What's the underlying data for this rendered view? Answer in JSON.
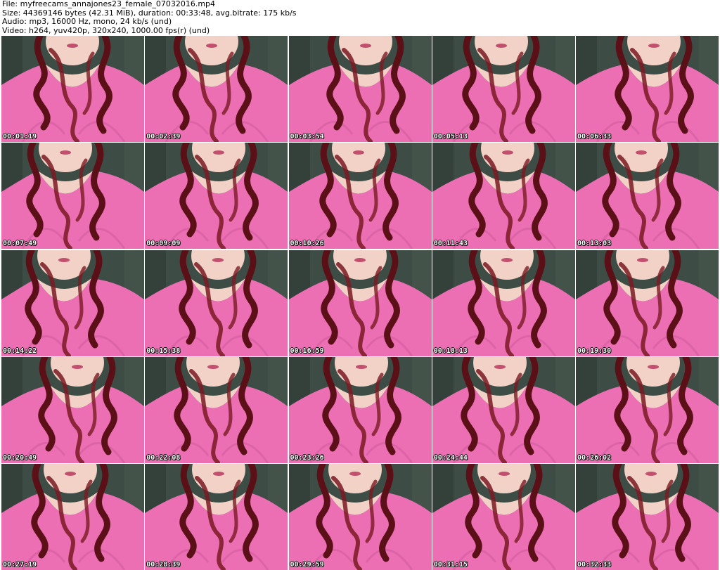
{
  "header": {
    "file_line": "File: myfreecams_annajones23_female_07032016.mp4",
    "size_line": "Size: 44369146 bytes (42.31 MiB), duration: 00:33:48, avg.bitrate: 175 kb/s",
    "audio_line": "Audio: mp3, 16000 Hz, mono, 24 kb/s (und)",
    "video_line": "Video: h264, yuv420p, 320x240, 1000.00 fps(r) (und)"
  },
  "colors": {
    "background": "#ffffff",
    "header_text": "#000000",
    "frame_backdrop": "#3d4d45",
    "shirt_pink": "#ec6fb4",
    "hair_auburn": "#5a1016",
    "skin": "#f2d2c6"
  },
  "frames": [
    {
      "timestamp": "00:01:19"
    },
    {
      "timestamp": "00:02:39"
    },
    {
      "timestamp": "00:03:54"
    },
    {
      "timestamp": "00:05:13"
    },
    {
      "timestamp": "00:06:33"
    },
    {
      "timestamp": "00:07:49"
    },
    {
      "timestamp": "00:09:09"
    },
    {
      "timestamp": "00:10:26"
    },
    {
      "timestamp": "00:11:43"
    },
    {
      "timestamp": "00:13:03"
    },
    {
      "timestamp": "00:14:22"
    },
    {
      "timestamp": "00:15:38"
    },
    {
      "timestamp": "00:16:59"
    },
    {
      "timestamp": "00:18:13"
    },
    {
      "timestamp": "00:19:30"
    },
    {
      "timestamp": "00:20:49"
    },
    {
      "timestamp": "00:22:08"
    },
    {
      "timestamp": "00:23:26"
    },
    {
      "timestamp": "00:24:44"
    },
    {
      "timestamp": "00:26:02"
    },
    {
      "timestamp": "00:27:19"
    },
    {
      "timestamp": "00:28:39"
    },
    {
      "timestamp": "00:29:59"
    },
    {
      "timestamp": "00:31:15"
    },
    {
      "timestamp": "00:32:33"
    }
  ]
}
